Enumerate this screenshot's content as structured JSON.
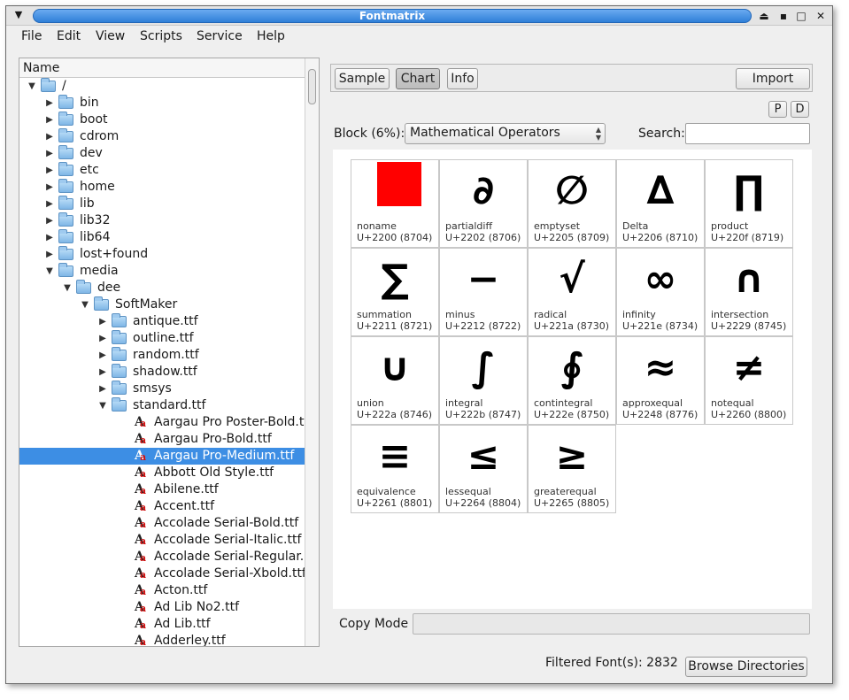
{
  "window": {
    "title": "Fontmatrix",
    "menu_glyph": "▼",
    "controls": [
      "⏏",
      "▪",
      "□",
      "✕"
    ]
  },
  "menubar": [
    {
      "label": "File"
    },
    {
      "label": "Edit"
    },
    {
      "label": "View"
    },
    {
      "label": "Scripts"
    },
    {
      "label": "Service"
    },
    {
      "label": "Help"
    }
  ],
  "tree": {
    "header": "Name",
    "rows": [
      {
        "label": "/",
        "depth": 0,
        "type": "folder",
        "expanded": true
      },
      {
        "label": "bin",
        "depth": 1,
        "type": "folder",
        "expanded": false
      },
      {
        "label": "boot",
        "depth": 1,
        "type": "folder",
        "expanded": false
      },
      {
        "label": "cdrom",
        "depth": 1,
        "type": "folder",
        "expanded": false
      },
      {
        "label": "dev",
        "depth": 1,
        "type": "folder",
        "expanded": false
      },
      {
        "label": "etc",
        "depth": 1,
        "type": "folder",
        "expanded": false
      },
      {
        "label": "home",
        "depth": 1,
        "type": "folder",
        "expanded": false
      },
      {
        "label": "lib",
        "depth": 1,
        "type": "folder",
        "expanded": false
      },
      {
        "label": "lib32",
        "depth": 1,
        "type": "folder",
        "expanded": false
      },
      {
        "label": "lib64",
        "depth": 1,
        "type": "folder",
        "expanded": false
      },
      {
        "label": "lost+found",
        "depth": 1,
        "type": "folder",
        "expanded": false
      },
      {
        "label": "media",
        "depth": 1,
        "type": "folder",
        "expanded": true
      },
      {
        "label": "dee",
        "depth": 2,
        "type": "folder",
        "expanded": true
      },
      {
        "label": "SoftMaker",
        "depth": 3,
        "type": "folder",
        "expanded": true
      },
      {
        "label": "antique.ttf",
        "depth": 4,
        "type": "folder",
        "expanded": false
      },
      {
        "label": "outline.ttf",
        "depth": 4,
        "type": "folder",
        "expanded": false
      },
      {
        "label": "random.ttf",
        "depth": 4,
        "type": "folder",
        "expanded": false
      },
      {
        "label": "shadow.ttf",
        "depth": 4,
        "type": "folder",
        "expanded": false
      },
      {
        "label": "smsys",
        "depth": 4,
        "type": "folder",
        "expanded": false
      },
      {
        "label": "standard.ttf",
        "depth": 4,
        "type": "folder",
        "expanded": true
      },
      {
        "label": "Aargau Pro Poster-Bold.ttf",
        "depth": 5,
        "type": "font"
      },
      {
        "label": "Aargau Pro-Bold.ttf",
        "depth": 5,
        "type": "font"
      },
      {
        "label": "Aargau Pro-Medium.ttf",
        "depth": 5,
        "type": "font",
        "selected": true
      },
      {
        "label": "Abbott Old Style.ttf",
        "depth": 5,
        "type": "font"
      },
      {
        "label": "Abilene.ttf",
        "depth": 5,
        "type": "font"
      },
      {
        "label": "Accent.ttf",
        "depth": 5,
        "type": "font"
      },
      {
        "label": "Accolade Serial-Bold.ttf",
        "depth": 5,
        "type": "font"
      },
      {
        "label": "Accolade Serial-Italic.ttf",
        "depth": 5,
        "type": "font"
      },
      {
        "label": "Accolade Serial-Regular...",
        "depth": 5,
        "type": "font"
      },
      {
        "label": "Accolade Serial-Xbold.ttf",
        "depth": 5,
        "type": "font"
      },
      {
        "label": "Acton.ttf",
        "depth": 5,
        "type": "font"
      },
      {
        "label": "Ad Lib No2.ttf",
        "depth": 5,
        "type": "font"
      },
      {
        "label": "Ad Lib.ttf",
        "depth": 5,
        "type": "font"
      },
      {
        "label": "Adderley.ttf",
        "depth": 5,
        "type": "font"
      }
    ]
  },
  "tabs": {
    "sample": "Sample",
    "chart": "Chart",
    "info": "Info",
    "import": "Import",
    "active": "chart"
  },
  "small_buttons": {
    "p": "P",
    "d": "D"
  },
  "block": {
    "label": "Block (6%):",
    "selected": "Mathematical Operators"
  },
  "search": {
    "label": "Search:",
    "value": ""
  },
  "glyphs": [
    {
      "char": "",
      "name": "noname",
      "code": "U+2200 (8704)",
      "missing": true
    },
    {
      "char": "∂",
      "name": "partialdiff",
      "code": "U+2202 (8706)"
    },
    {
      "char": "∅",
      "name": "emptyset",
      "code": "U+2205 (8709)"
    },
    {
      "char": "∆",
      "name": "Delta",
      "code": "U+2206 (8710)"
    },
    {
      "char": "∏",
      "name": "product",
      "code": "U+220f (8719)"
    },
    {
      "char": "∑",
      "name": "summation",
      "code": "U+2211 (8721)"
    },
    {
      "char": "−",
      "name": "minus",
      "code": "U+2212 (8722)"
    },
    {
      "char": "√",
      "name": "radical",
      "code": "U+221a (8730)"
    },
    {
      "char": "∞",
      "name": "infinity",
      "code": "U+221e (8734)"
    },
    {
      "char": "∩",
      "name": "intersection",
      "code": "U+2229 (8745)"
    },
    {
      "char": "∪",
      "name": "union",
      "code": "U+222a (8746)"
    },
    {
      "char": "∫",
      "name": "integral",
      "code": "U+222b (8747)"
    },
    {
      "char": "∮",
      "name": "contintegral",
      "code": "U+222e (8750)"
    },
    {
      "char": "≈",
      "name": "approxequal",
      "code": "U+2248 (8776)"
    },
    {
      "char": "≠",
      "name": "notequal",
      "code": "U+2260 (8800)"
    },
    {
      "char": "≡",
      "name": "equivalence",
      "code": "U+2261 (8801)"
    },
    {
      "char": "≤",
      "name": "lessequal",
      "code": "U+2264 (8804)"
    },
    {
      "char": "≥",
      "name": "greaterequal",
      "code": "U+2265 (8805)"
    }
  ],
  "copy_mode": {
    "label": "Copy Mode",
    "value": ""
  },
  "status": {
    "filtered": "Filtered Font(s): 2832",
    "browse": "Browse Directories"
  },
  "colors": {
    "selection": "#3d8ee4",
    "title_bar": "#2f7fd8",
    "missing_glyph": "#ff0000"
  }
}
